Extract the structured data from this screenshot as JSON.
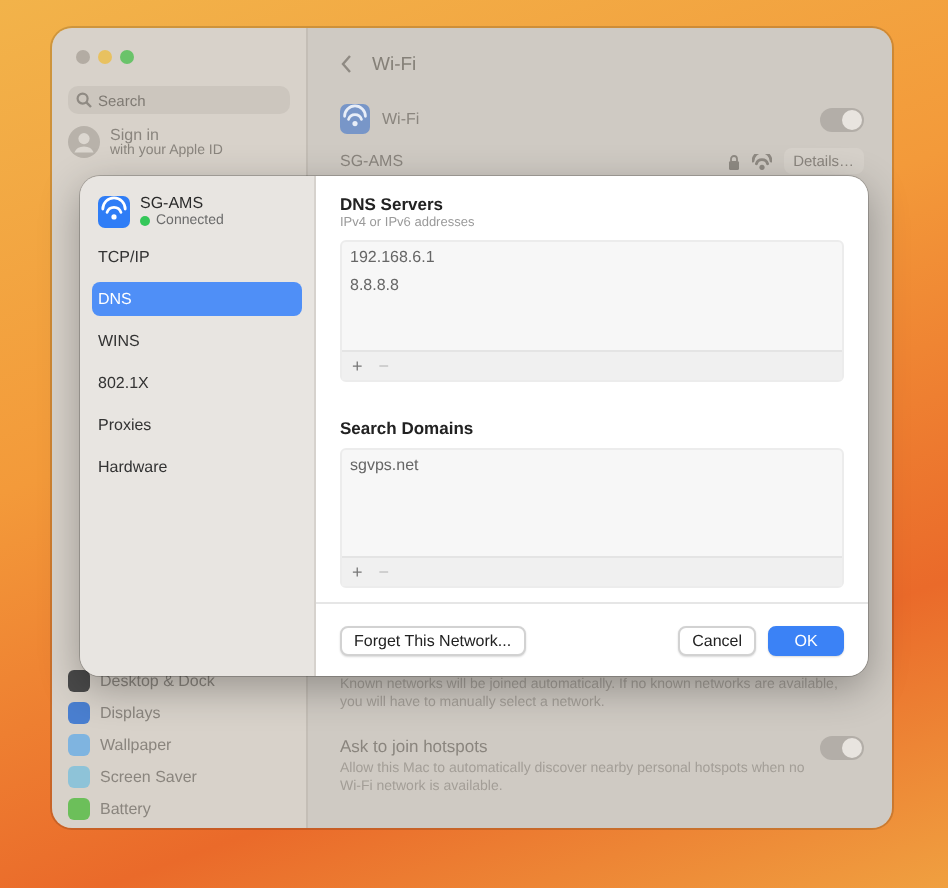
{
  "window": {
    "sidebar": {
      "search": {
        "placeholder": "Search"
      },
      "account": {
        "title": "Sign in",
        "subtitle": "with your Apple ID"
      },
      "items": [
        {
          "label": "Desktop & Dock",
          "color": "#4a4a4a"
        },
        {
          "label": "Displays",
          "color": "#4a7fd0"
        },
        {
          "label": "Wallpaper",
          "color": "#7fb4e0"
        },
        {
          "label": "Screen Saver",
          "color": "#8ec3d8"
        },
        {
          "label": "Battery",
          "color": "#6cbf5a"
        }
      ]
    },
    "main": {
      "title": "Wi-Fi",
      "wifi": {
        "label": "Wi-Fi",
        "on": true
      },
      "network": {
        "name": "SG-AMS",
        "details_button": "Details…"
      },
      "networks_description": "Known networks will be joined automatically. If no known networks are available, you will have to manually select a network.",
      "hotspots": {
        "title": "Ask to join hotspots",
        "description": "Allow this Mac to automatically discover nearby personal hotspots when no Wi-Fi network is available.",
        "on": true
      }
    }
  },
  "dialog": {
    "network": {
      "name": "SG-AMS",
      "status": "Connected",
      "connected": true
    },
    "tabs": [
      {
        "label": "TCP/IP",
        "selected": false
      },
      {
        "label": "DNS",
        "selected": true
      },
      {
        "label": "WINS",
        "selected": false
      },
      {
        "label": "802.1X",
        "selected": false
      },
      {
        "label": "Proxies",
        "selected": false
      },
      {
        "label": "Hardware",
        "selected": false
      }
    ],
    "dns_servers": {
      "title": "DNS Servers",
      "subtitle": "IPv4 or IPv6 addresses",
      "entries": [
        "192.168.6.1",
        "8.8.8.8"
      ],
      "add": "+",
      "remove": "−"
    },
    "search_domains": {
      "title": "Search Domains",
      "entries": [
        "sgvps.net"
      ],
      "add": "+",
      "remove": "−"
    },
    "buttons": {
      "forget": "Forget This Network...",
      "cancel": "Cancel",
      "ok": "OK"
    }
  }
}
